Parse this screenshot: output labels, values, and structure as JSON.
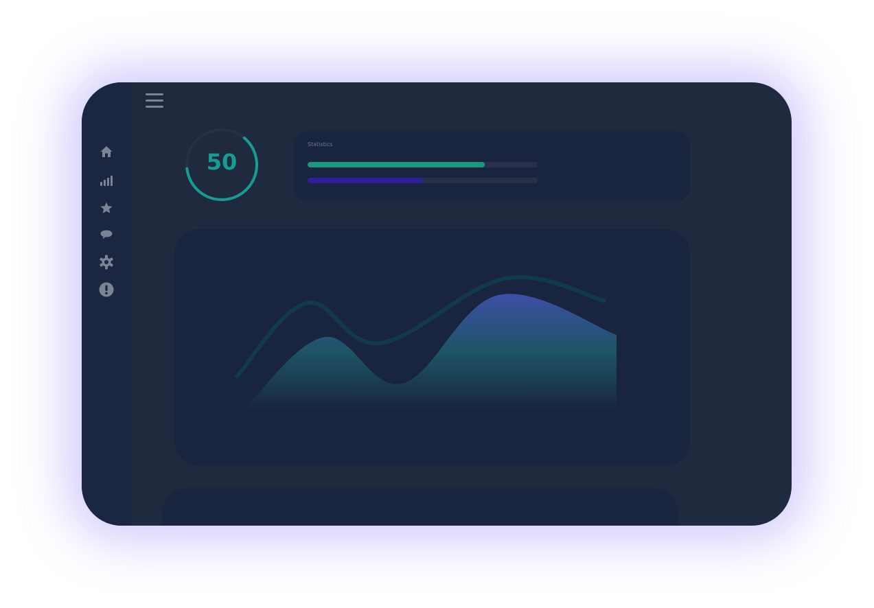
{
  "gauge": {
    "value": "50",
    "progress": 0.62,
    "color": "#169d93",
    "track_color": "#2b2f42"
  },
  "statistics": {
    "title": "Statistics",
    "bars": [
      {
        "name": "bar-teal",
        "progress": 0.77,
        "color": "#1b9883"
      },
      {
        "name": "bar-indigo",
        "progress": 0.5,
        "color": "#2d1f9e"
      }
    ]
  },
  "sidebar": {
    "items": [
      {
        "icon": "home-icon"
      },
      {
        "icon": "signal-bars-icon"
      },
      {
        "icon": "star-icon"
      },
      {
        "icon": "chat-bubble-icon"
      },
      {
        "icon": "gear-icon"
      },
      {
        "icon": "alert-icon"
      }
    ],
    "icon_color": "#7b8394"
  },
  "header": {
    "menu_icon": "hamburger-menu-icon"
  },
  "colors": {
    "device_bg": "#202a3e",
    "sidebar_bg": "#1b2740",
    "card_bg": "#19243e",
    "glow": "#7d69f5"
  },
  "chart_data": {
    "type": "area",
    "series": [
      {
        "style": "line",
        "color": "#123a4e",
        "x": [
          0,
          0.19,
          0.39,
          0.73,
          1.0
        ],
        "y": [
          0.12,
          0.78,
          0.42,
          1.0,
          0.8
        ]
      },
      {
        "style": "area",
        "gradient": [
          "#3e4fa6",
          "#1d5464",
          "#19243e"
        ],
        "x": [
          0.0,
          0.21,
          0.42,
          0.68,
          1.0
        ],
        "y": [
          0.0,
          0.62,
          0.2,
          1.0,
          0.64
        ]
      }
    ]
  }
}
